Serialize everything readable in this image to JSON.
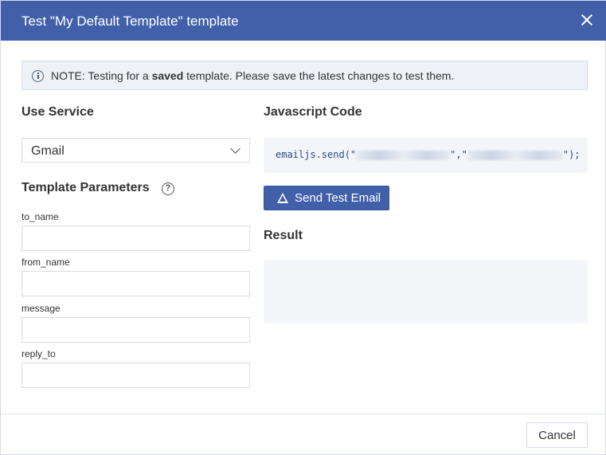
{
  "header": {
    "title": "Test \"My Default Template\" template"
  },
  "note": {
    "prefix": "NOTE: Testing for a ",
    "bold": "saved",
    "suffix": " template. Please save the latest changes to test them."
  },
  "service": {
    "label": "Use Service",
    "selected": "Gmail"
  },
  "params": {
    "label": "Template Parameters",
    "fields": [
      {
        "name": "to_name",
        "value": ""
      },
      {
        "name": "from_name",
        "value": ""
      },
      {
        "name": "message",
        "value": ""
      },
      {
        "name": "reply_to",
        "value": ""
      }
    ]
  },
  "code": {
    "label": "Javascript Code",
    "prefix": "emailjs.send(\"",
    "middle": "\",\"",
    "suffix": "\");"
  },
  "send_button": {
    "label": "Send Test Email"
  },
  "result": {
    "label": "Result",
    "content": ""
  },
  "footer": {
    "cancel_label": "Cancel"
  },
  "colors": {
    "accent": "#4160a9",
    "panel": "#f3f5f8",
    "note_bg": "#eef2f7"
  },
  "icons": {
    "close": "close-icon",
    "info": "info-icon",
    "help": "help-icon",
    "warning": "warning-icon",
    "chevron": "chevron-down-icon"
  }
}
